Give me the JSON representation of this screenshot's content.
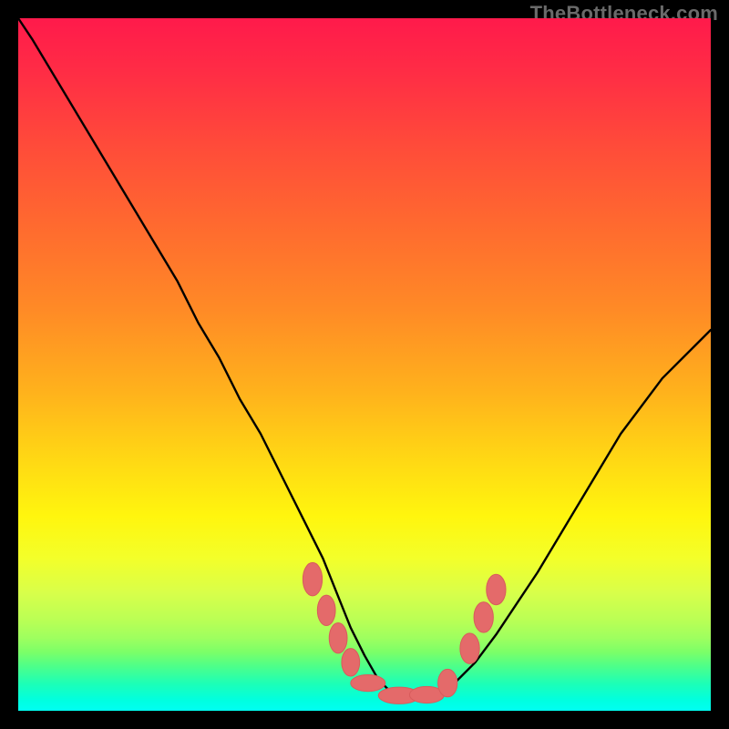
{
  "watermark": {
    "text": "TheBottleneck.com"
  },
  "chart_data": {
    "type": "line",
    "title": "",
    "xlabel": "",
    "ylabel": "",
    "xlim": [
      0,
      100
    ],
    "ylim": [
      0,
      100
    ],
    "grid": false,
    "series": [
      {
        "name": "curve",
        "x": [
          0,
          2,
          5,
          8,
          11,
          14,
          17,
          20,
          23,
          26,
          29,
          32,
          35,
          38,
          41,
          44,
          46,
          48,
          50,
          52,
          54,
          56,
          58,
          60,
          63,
          66,
          69,
          72,
          75,
          78,
          81,
          84,
          87,
          90,
          93,
          96,
          99,
          100
        ],
        "y": [
          100,
          97,
          92,
          87,
          82,
          77,
          72,
          67,
          62,
          56,
          51,
          45,
          40,
          34,
          28,
          22,
          17,
          12,
          8,
          4.5,
          2.5,
          2,
          2,
          2.5,
          4,
          7,
          11,
          15.5,
          20,
          25,
          30,
          35,
          40,
          44,
          48,
          51,
          54,
          55
        ]
      }
    ],
    "markers": [
      {
        "x": 42.5,
        "y": 19,
        "rx": 1.4,
        "ry": 2.4
      },
      {
        "x": 44.5,
        "y": 14.5,
        "rx": 1.3,
        "ry": 2.2
      },
      {
        "x": 46.2,
        "y": 10.5,
        "rx": 1.3,
        "ry": 2.2
      },
      {
        "x": 48.0,
        "y": 7.0,
        "rx": 1.3,
        "ry": 2.0
      },
      {
        "x": 50.5,
        "y": 4.0,
        "rx": 2.5,
        "ry": 1.2
      },
      {
        "x": 55.0,
        "y": 2.2,
        "rx": 3.0,
        "ry": 1.2
      },
      {
        "x": 59.0,
        "y": 2.3,
        "rx": 2.5,
        "ry": 1.2
      },
      {
        "x": 62.0,
        "y": 4.0,
        "rx": 1.4,
        "ry": 2.0
      },
      {
        "x": 65.2,
        "y": 9.0,
        "rx": 1.4,
        "ry": 2.2
      },
      {
        "x": 67.2,
        "y": 13.5,
        "rx": 1.4,
        "ry": 2.2
      },
      {
        "x": 69.0,
        "y": 17.5,
        "rx": 1.4,
        "ry": 2.2
      }
    ],
    "colors": {
      "line": "#000000",
      "marker_fill": "#e46a6a",
      "marker_stroke": "#d85c5c"
    }
  }
}
